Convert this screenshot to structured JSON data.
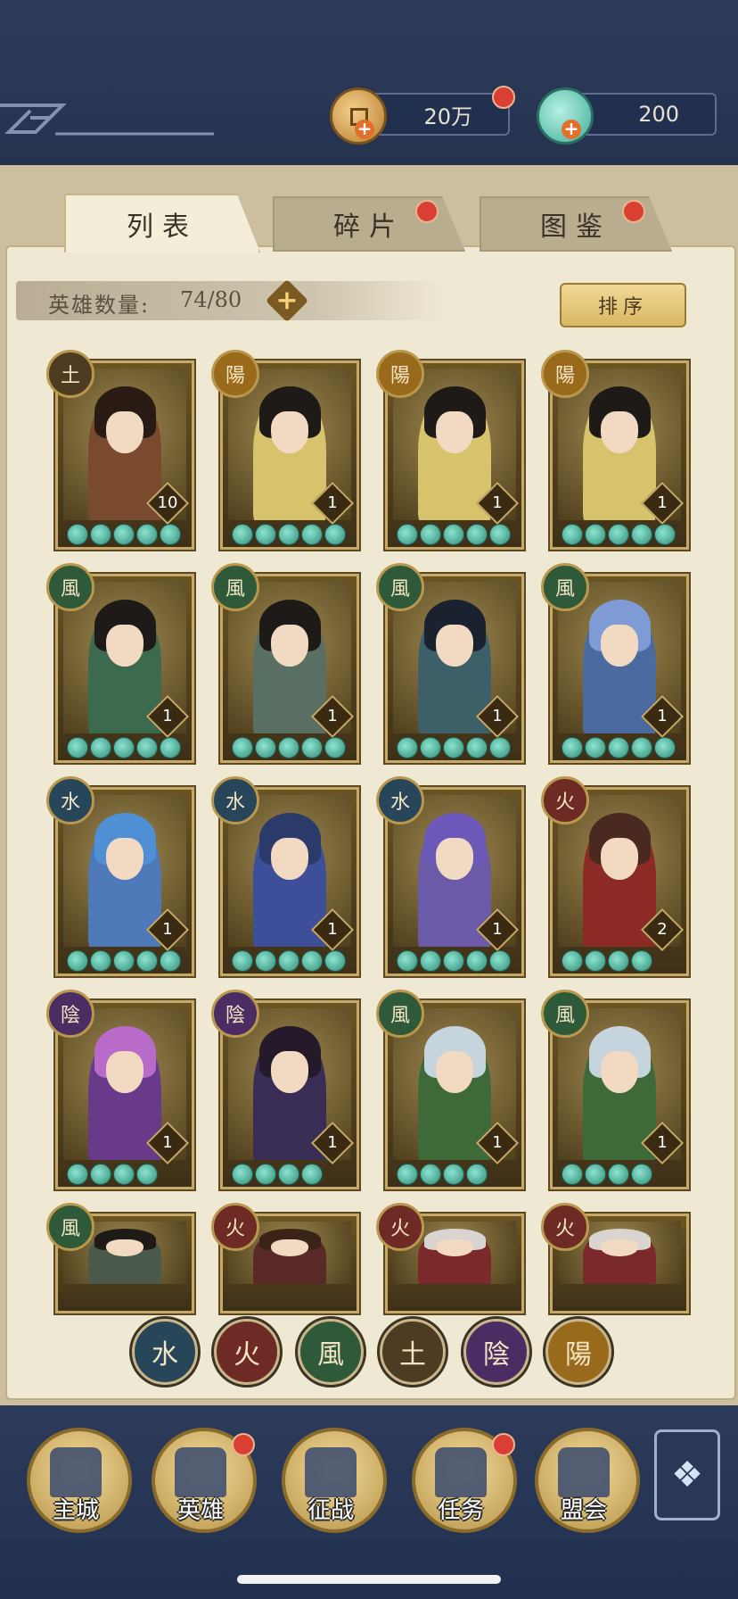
{
  "currency": {
    "coins": "20万",
    "shells": "200"
  },
  "tabs": [
    {
      "label": "列表",
      "active": true
    },
    {
      "label": "碎片",
      "active": false
    },
    {
      "label": "图鉴",
      "active": false
    }
  ],
  "hero_count": {
    "label": "英雄数量:",
    "value": "74/80"
  },
  "sort_label": "排序",
  "elements": {
    "earth": "土",
    "yang": "陽",
    "wind": "風",
    "water": "水",
    "fire": "火",
    "yin": "陰"
  },
  "heroes": [
    {
      "element": "earth",
      "level": "10",
      "stars": 5
    },
    {
      "element": "yang",
      "level": "1",
      "stars": 5
    },
    {
      "element": "yang",
      "level": "1",
      "stars": 5
    },
    {
      "element": "yang",
      "level": "1",
      "stars": 5
    },
    {
      "element": "wind",
      "level": "1",
      "stars": 5
    },
    {
      "element": "wind",
      "level": "1",
      "stars": 5
    },
    {
      "element": "wind",
      "level": "1",
      "stars": 5
    },
    {
      "element": "wind",
      "level": "1",
      "stars": 5
    },
    {
      "element": "water",
      "level": "1",
      "stars": 5
    },
    {
      "element": "water",
      "level": "1",
      "stars": 5
    },
    {
      "element": "water",
      "level": "1",
      "stars": 5
    },
    {
      "element": "fire",
      "level": "2",
      "stars": 4
    },
    {
      "element": "yin",
      "level": "1",
      "stars": 4
    },
    {
      "element": "yin",
      "level": "1",
      "stars": 4
    },
    {
      "element": "wind",
      "level": "1",
      "stars": 4
    },
    {
      "element": "wind",
      "level": "1",
      "stars": 4
    },
    {
      "element": "wind",
      "level": "",
      "stars": 0
    },
    {
      "element": "fire",
      "level": "",
      "stars": 0
    },
    {
      "element": "fire",
      "level": "",
      "stars": 0
    },
    {
      "element": "fire",
      "level": "",
      "stars": 0
    }
  ],
  "filter_order": [
    "water",
    "fire",
    "wind",
    "earth",
    "yin",
    "yang"
  ],
  "nav": [
    {
      "label": "主城",
      "dot": false
    },
    {
      "label": "英雄",
      "dot": true
    },
    {
      "label": "征战",
      "dot": false
    },
    {
      "label": "任务",
      "dot": true
    },
    {
      "label": "盟会",
      "dot": false
    }
  ],
  "colors": {
    "earth": "#4d3b22",
    "yang": "#9a6a1c",
    "wind": "#2f5a3a",
    "water": "#274659",
    "fire": "#6e2a24",
    "yin": "#4c2d63"
  }
}
